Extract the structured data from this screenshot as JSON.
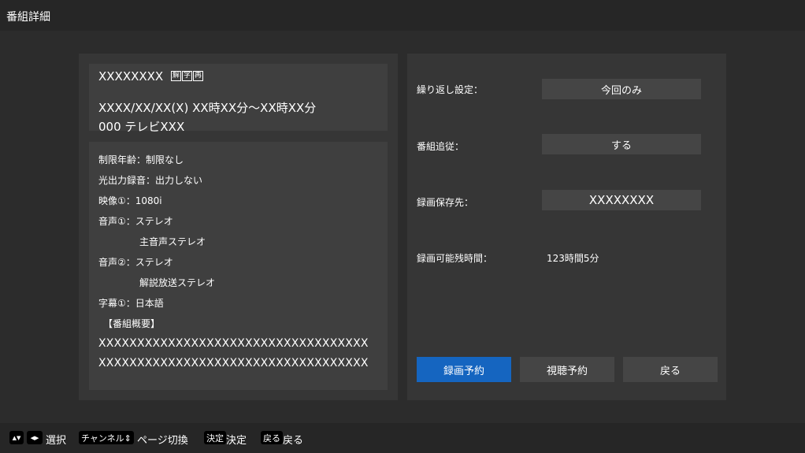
{
  "header": {
    "title": "番組詳細"
  },
  "program": {
    "title": "XXXXXXXX",
    "badges": [
      "解",
      "字",
      "再"
    ],
    "datetime": "XXXX/XX/XX(X) XX時XX分〜XX時XX分",
    "channel": "000 テレビXXX"
  },
  "info": {
    "age_limit": "制限年齢：制限なし",
    "optical_rec": "光出力録音：出力しない",
    "video": "映像①：1080i",
    "audio1": "音声①：ステレオ",
    "audio1_sub": "主音声ステレオ",
    "audio2": "音声②：ステレオ",
    "audio2_sub": "解説放送ステレオ",
    "subtitle": "字幕①：日本語",
    "summary_heading": "【番組概要】",
    "summary_line1": "XXXXXXXXXXXXXXXXXXXXXXXXXXXXXXXXXXX",
    "summary_line2": "XXXXXXXXXXXXXXXXXXXXXXXXXXXXXXXXXXX"
  },
  "settings": {
    "repeat_label": "繰り返し設定：",
    "repeat_value": "今回のみ",
    "follow_label": "番組追従：",
    "follow_value": "する",
    "dest_label": "録画保存先：",
    "dest_value": "XXXXXXXX",
    "remain_label": "録画可能残時間：",
    "remain_value": "123時間5分"
  },
  "buttons": {
    "record": "録画予約",
    "watch": "視聴予約",
    "back": "戻る"
  },
  "footer": {
    "updown_key": "▲▼",
    "leftright_key": "◀▶",
    "select_label": "選択",
    "channel_key": "チャンネル⇕",
    "page_label": "ページ切換",
    "decide_key": "決定",
    "decide_label": "決定",
    "back_key": "戻る",
    "back_label": "戻る"
  }
}
